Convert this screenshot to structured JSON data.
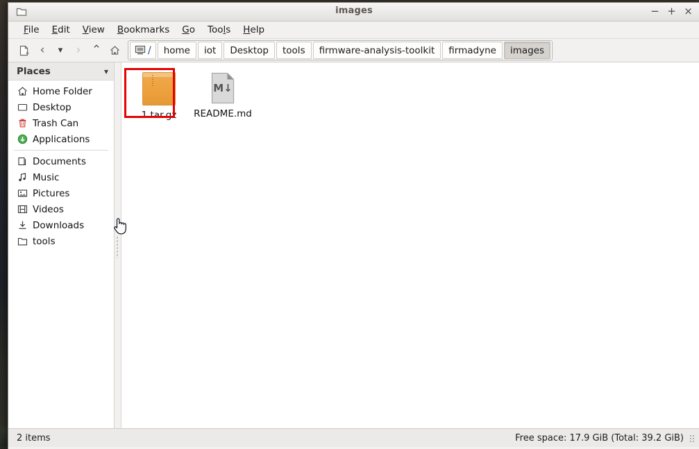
{
  "window": {
    "title": "images",
    "icon": "folder-icon",
    "controls": {
      "minimize": "−",
      "maximize": "+",
      "close": "×"
    }
  },
  "menubar": {
    "items": [
      {
        "label": "File",
        "mnemonic": "F"
      },
      {
        "label": "Edit",
        "mnemonic": "E"
      },
      {
        "label": "View",
        "mnemonic": "V"
      },
      {
        "label": "Bookmarks",
        "mnemonic": "B"
      },
      {
        "label": "Go",
        "mnemonic": "G"
      },
      {
        "label": "Tools",
        "mnemonic": "l"
      },
      {
        "label": "Help",
        "mnemonic": "H"
      }
    ]
  },
  "toolbar": {
    "buttons": [
      {
        "name": "new-tab-icon",
        "glyph": ""
      },
      {
        "name": "back-icon",
        "glyph": "‹"
      },
      {
        "name": "history-dropdown-icon",
        "glyph": "⌄"
      },
      {
        "name": "forward-icon",
        "glyph": "›"
      },
      {
        "name": "up-icon",
        "glyph": "⌃"
      },
      {
        "name": "home-icon",
        "glyph": ""
      }
    ]
  },
  "pathbar": {
    "root_label": "/",
    "crumbs": [
      {
        "label": "home",
        "active": false
      },
      {
        "label": "iot",
        "active": false
      },
      {
        "label": "Desktop",
        "active": false
      },
      {
        "label": "tools",
        "active": false
      },
      {
        "label": "firmware-analysis-toolkit",
        "active": false
      },
      {
        "label": "firmadyne",
        "active": false
      },
      {
        "label": "images",
        "active": true
      }
    ]
  },
  "sidebar": {
    "header": "Places",
    "items": [
      {
        "label": "Home Folder",
        "icon": "home-icon"
      },
      {
        "label": "Desktop",
        "icon": "desktop-icon"
      },
      {
        "label": "Trash Can",
        "icon": "trash-icon"
      },
      {
        "label": "Applications",
        "icon": "applications-icon"
      },
      {
        "label": "Documents",
        "icon": "documents-icon"
      },
      {
        "label": "Music",
        "icon": "music-icon"
      },
      {
        "label": "Pictures",
        "icon": "pictures-icon"
      },
      {
        "label": "Videos",
        "icon": "videos-icon"
      },
      {
        "label": "Downloads",
        "icon": "downloads-icon"
      },
      {
        "label": "tools",
        "icon": "folder-icon"
      }
    ]
  },
  "files": [
    {
      "name": "1.tar.gz",
      "icon": "archive-icon",
      "selected": true,
      "annotated": true
    },
    {
      "name": "README.md",
      "icon": "markdown-file-icon",
      "selected": false,
      "annotated": false
    }
  ],
  "statusbar": {
    "item_count": "2 items",
    "free_space": "Free space: 17.9 GiB (Total: 39.2 GiB)"
  },
  "colors": {
    "annotation": "#e60000",
    "archive": "#eea23f",
    "window_bg": "#f2f1f0",
    "active_crumb": "#d6d2ce"
  }
}
